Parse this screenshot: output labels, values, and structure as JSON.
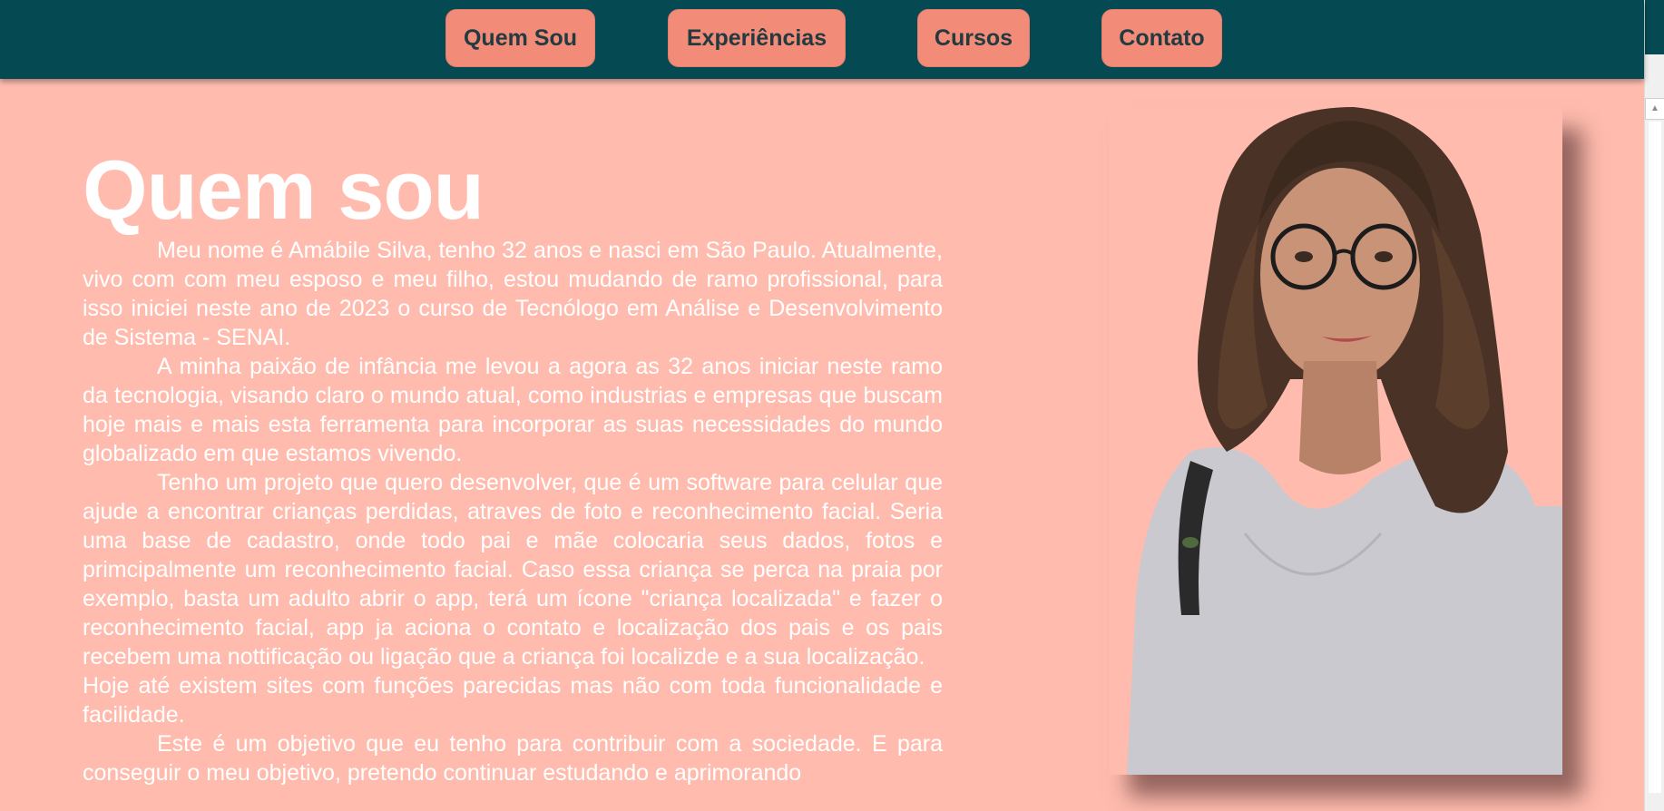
{
  "nav": {
    "items": [
      {
        "label": "Quem Sou"
      },
      {
        "label": "Experiências"
      },
      {
        "label": "Cursos"
      },
      {
        "label": "Contato"
      }
    ]
  },
  "main": {
    "title": "Quem sou",
    "paragraphs": [
      "Meu nome é Amábile Silva, tenho 32 anos e nasci em São Paulo. Atualmente, vivo com com meu esposo e meu filho, estou mudando de ramo profissional, para isso iniciei neste ano de 2023 o curso de Tecnólogo em Análise e Desenvolvimento de Sistema - SENAI.",
      "A minha paixão de infância me levou a agora as 32 anos iniciar neste ramo da tecnologia, visando claro o mundo atual, como industrias e empresas que buscam hoje mais e mais esta ferramenta para incorporar as suas necessidades do mundo globalizado em que estamos vivendo.",
      "Tenho um projeto que quero desenvolver, que é um software para celular que ajude a encontrar crianças perdidas, atraves de foto e reconhecimento facial. Seria uma base de cadastro, onde todo pai e mãe colocaria seus dados, fotos e primcipalmente um reconhecimento facial. Caso essa criança se perca na praia por exemplo, basta um adulto abrir o app, terá um ícone \"criança localizada\" e fazer o reconhecimento facial, app ja aciona o contato e localização dos pais e os pais recebem uma nottificação ou ligação que a criança foi localizde e a sua localização.",
      "Hoje até existem sites com funções parecidas mas não com toda funcionalidade e facilidade.",
      "Este é um objetivo que eu tenho para contribuir com a sociedade. E para conseguir o meu objetivo, pretendo continuar estudando e aprimorando"
    ]
  },
  "colors": {
    "navbar": "#054a53",
    "page_background": "#ffbcae",
    "nav_button": "#f28b78",
    "nav_text": "#223a40",
    "body_text": "#ffffff"
  },
  "profile_photo": {
    "icon": "portrait-photo"
  }
}
